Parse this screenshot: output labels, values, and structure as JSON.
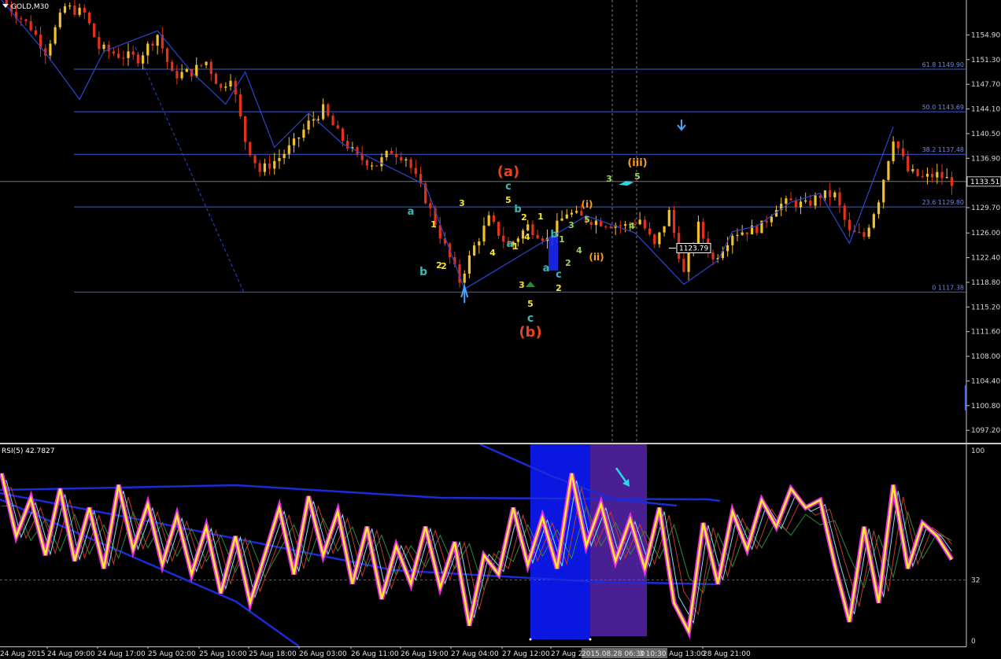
{
  "symbol": {
    "title": "GOLD,M30",
    "menu_icon": "triangle-down-icon"
  },
  "price_axis": {
    "min": 1095.5,
    "max": 1160.0,
    "ticks": [
      1154.9,
      1151.3,
      1147.7,
      1144.1,
      1140.5,
      1136.9,
      1133.3,
      1129.7,
      1126.0,
      1122.4,
      1118.8,
      1115.2,
      1111.6,
      1108.0,
      1104.4,
      1100.8,
      1097.2
    ],
    "tick_labels": [
      "1154.90",
      "1151.30",
      "1147.70",
      "1144.10",
      "1140.50",
      "1136.90",
      "1133.30",
      "1129.70",
      "1126.00",
      "1122.40",
      "1118.80",
      "1115.20",
      "1111.60",
      "1108.00",
      "1104.40",
      "1100.80",
      "1097.20"
    ],
    "current_price": 1133.51,
    "current_price_label": "1133.51",
    "box_price": 1123.79,
    "box_label": "1123.79"
  },
  "fibonacci": [
    {
      "price": 1149.9,
      "label": "61.8 1149.90"
    },
    {
      "price": 1143.69,
      "label": "50.0 1143.69"
    },
    {
      "price": 1137.48,
      "label": "38.2 1137.48"
    },
    {
      "price": 1129.8,
      "label": "23.6 1129.80"
    },
    {
      "price": 1117.38,
      "label": "0 1117.38"
    }
  ],
  "chart_data": [
    {
      "type": "candlestick",
      "title": "GOLD,M30",
      "n_bars": 160,
      "ylim": [
        1095.5,
        1160.0
      ],
      "close_path": [
        [
          0,
          1160
        ],
        [
          6,
          1156
        ],
        [
          9,
          1152.5
        ],
        [
          13,
          1159
        ],
        [
          17,
          1158
        ],
        [
          20,
          1153
        ],
        [
          24,
          1152
        ],
        [
          28,
          1151.5
        ],
        [
          32,
          1155
        ],
        [
          35,
          1149
        ],
        [
          39,
          1149.5
        ],
        [
          42,
          1151
        ],
        [
          45,
          1147
        ],
        [
          47,
          1149
        ],
        [
          50,
          1139.5
        ],
        [
          53,
          1135
        ],
        [
          57,
          1137
        ],
        [
          60,
          1139
        ],
        [
          63,
          1142
        ],
        [
          66,
          1144
        ],
        [
          69,
          1140.5
        ],
        [
          73,
          1137
        ],
        [
          77,
          1136
        ],
        [
          80,
          1138
        ],
        [
          83,
          1137
        ],
        [
          87,
          1131
        ],
        [
          91,
          1124
        ],
        [
          94,
          1119
        ],
        [
          97,
          1124
        ],
        [
          100,
          1128
        ],
        [
          104,
          1124
        ],
        [
          108,
          1127
        ],
        [
          112,
          1125
        ],
        [
          116,
          1129
        ],
        [
          120,
          1128
        ],
        [
          124,
          1127.5
        ],
        [
          128,
          1127
        ],
        [
          131,
          1128
        ],
        [
          134,
          1124
        ],
        [
          137,
          1129
        ],
        [
          140,
          1120
        ],
        [
          143,
          1127
        ],
        [
          146,
          1122
        ],
        [
          150,
          1126
        ],
        [
          154,
          1126.5
        ],
        [
          156,
          1127
        ],
        [
          159,
          1130
        ],
        [
          162,
          1130.5
        ],
        [
          165,
          1130
        ],
        [
          168,
          1131.5
        ],
        [
          171,
          1131.5
        ],
        [
          174,
          1126
        ],
        [
          177,
          1125.5
        ],
        [
          180,
          1131
        ],
        [
          183,
          1140
        ],
        [
          186,
          1135
        ],
        [
          189,
          1134
        ],
        [
          192,
          1134.5
        ],
        [
          195,
          1133.5
        ]
      ],
      "xlabel": "",
      "ylabel": ""
    },
    {
      "type": "line",
      "title": "RSI(5) 42.7827",
      "ylim": [
        0,
        100
      ],
      "levels": [
        32
      ],
      "level_labels": [
        "100",
        "32",
        "0"
      ],
      "rsi_path": [
        [
          0,
          88
        ],
        [
          3,
          55
        ],
        [
          6,
          75
        ],
        [
          9,
          45
        ],
        [
          12,
          80
        ],
        [
          15,
          42
        ],
        [
          18,
          70
        ],
        [
          21,
          38
        ],
        [
          24,
          82
        ],
        [
          27,
          48
        ],
        [
          30,
          72
        ],
        [
          33,
          40
        ],
        [
          36,
          66
        ],
        [
          39,
          35
        ],
        [
          42,
          60
        ],
        [
          45,
          25
        ],
        [
          48,
          55
        ],
        [
          51,
          20
        ],
        [
          54,
          45
        ],
        [
          57,
          70
        ],
        [
          60,
          35
        ],
        [
          63,
          76
        ],
        [
          66,
          45
        ],
        [
          69,
          68
        ],
        [
          72,
          30
        ],
        [
          75,
          60
        ],
        [
          78,
          22
        ],
        [
          81,
          50
        ],
        [
          84,
          30
        ],
        [
          87,
          60
        ],
        [
          90,
          28
        ],
        [
          93,
          52
        ],
        [
          96,
          8
        ],
        [
          99,
          45
        ],
        [
          102,
          35
        ],
        [
          105,
          70
        ],
        [
          108,
          40
        ],
        [
          111,
          65
        ],
        [
          114,
          38
        ],
        [
          117,
          88
        ],
        [
          120,
          50
        ],
        [
          123,
          72
        ],
        [
          126,
          42
        ],
        [
          129,
          64
        ],
        [
          132,
          38
        ],
        [
          135,
          70
        ],
        [
          138,
          20
        ],
        [
          141,
          5
        ],
        [
          144,
          62
        ],
        [
          147,
          30
        ],
        [
          150,
          68
        ],
        [
          153,
          48
        ],
        [
          156,
          74
        ],
        [
          159,
          60
        ],
        [
          162,
          80
        ],
        [
          165,
          70
        ],
        [
          168,
          74
        ],
        [
          171,
          40
        ],
        [
          174,
          10
        ],
        [
          177,
          60
        ],
        [
          180,
          20
        ],
        [
          183,
          82
        ],
        [
          186,
          38
        ],
        [
          189,
          62
        ],
        [
          192,
          55
        ],
        [
          195,
          42.78
        ]
      ],
      "xlabel": "",
      "ylabel": ""
    }
  ],
  "wave_labels": [
    {
      "text": "(a)",
      "color": "#e8441c"
    },
    {
      "text": "(b)",
      "color": "#e8441c"
    },
    {
      "text": "(iii)",
      "color": "#ff9d1e"
    },
    {
      "text": "(i)",
      "color": "#ff9d1e"
    },
    {
      "text": "(ii)",
      "color": "#ff9d1e"
    },
    {
      "text": "a",
      "color": "#3fb6b3"
    },
    {
      "text": "b",
      "color": "#3fb6b3"
    },
    {
      "text": "c",
      "color": "#3fb6b3"
    },
    {
      "text": "b",
      "color": "#3fb6b3"
    },
    {
      "text": "a",
      "color": "#3fb6b3"
    },
    {
      "text": "b",
      "color": "#3fb6b3"
    },
    {
      "text": "a",
      "color": "#3fb6b3"
    },
    {
      "text": "c",
      "color": "#3fb6b3"
    },
    {
      "text": "c",
      "color": "#3fb6b3"
    },
    {
      "text": "1",
      "color": "#f5e62a"
    },
    {
      "text": "2",
      "color": "#f5e62a"
    },
    {
      "text": "2",
      "color": "#f5e62a"
    },
    {
      "text": "3",
      "color": "#f5e62a"
    },
    {
      "text": "4",
      "color": "#f5e62a"
    },
    {
      "text": "5",
      "color": "#f5e62a"
    },
    {
      "text": "1",
      "color": "#f5e62a"
    },
    {
      "text": "2",
      "color": "#f5e62a"
    },
    {
      "text": "4",
      "color": "#f5e62a"
    },
    {
      "text": "3",
      "color": "#f5e62a"
    },
    {
      "text": "5",
      "color": "#f5e62a"
    },
    {
      "text": "1",
      "color": "#f5e62a"
    },
    {
      "text": "2",
      "color": "#f5e62a"
    },
    {
      "text": "1",
      "color": "#9bd65a"
    },
    {
      "text": "2",
      "color": "#9bd65a"
    },
    {
      "text": "3",
      "color": "#9bd65a"
    },
    {
      "text": "4",
      "color": "#9bd65a"
    },
    {
      "text": "5",
      "color": "#9bd65a"
    },
    {
      "text": "3",
      "color": "#9bd65a"
    },
    {
      "text": "5",
      "color": "#9bd65a"
    },
    {
      "text": "4",
      "color": "#9bd65a"
    }
  ],
  "time_axis": {
    "labels": [
      "24 Aug 2015",
      "24 Aug 09:00",
      "24 Aug 17:00",
      "25 Aug 02:00",
      "25 Aug 10:00",
      "25 Aug 18:00",
      "26 Aug 03:00",
      "26 Aug 11:00",
      "26 Aug 19:00",
      "27 Aug 04:00",
      "27 Aug 12:00",
      "27 Aug 2",
      "2015.08.28 06:30",
      "3 10:30",
      "Aug 13:00",
      "28 Aug 21:00"
    ]
  },
  "colors": {
    "background": "#000000",
    "bull_candle": "#f2c22b",
    "bear_candle": "#e3321c",
    "fib_line": "#3d5bd6",
    "zigzag": "#2847d0",
    "rsi_main": "#ffef2a",
    "rsi_glow": "#e82ce0",
    "blue_zone": "#0a17e0",
    "purple_zone": "#4b1f94"
  }
}
